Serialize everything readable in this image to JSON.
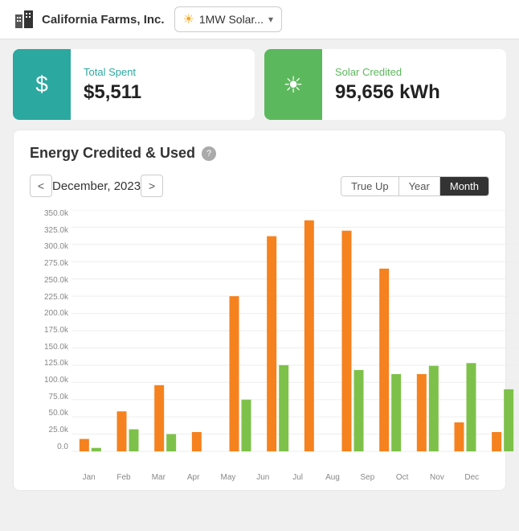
{
  "header": {
    "company": "California Farms, Inc.",
    "site": "1MW Solar...",
    "logo_alt": "building-icon"
  },
  "cards": [
    {
      "id": "total-spent",
      "icon": "$",
      "icon_color": "teal",
      "label": "Total Spent",
      "value": "$5,511"
    },
    {
      "id": "solar-credited",
      "icon": "☀",
      "icon_color": "green",
      "label": "Solar Credited",
      "value": "95,656 kWh"
    }
  ],
  "chart": {
    "title": "Energy Credited & Used",
    "help": "?",
    "nav": {
      "prev": "<",
      "next": ">",
      "date": "December, 2023"
    },
    "view_buttons": [
      "True Up",
      "Year",
      "Month"
    ],
    "active_view": "Month",
    "y_labels": [
      "350.0k",
      "325.0k",
      "300.0k",
      "275.0k",
      "250.0k",
      "225.0k",
      "200.0k",
      "175.0k",
      "150.0k",
      "125.0k",
      "100.0k",
      "75.0k",
      "50.0k",
      "25.0k",
      "0.0"
    ],
    "months": [
      "Jan",
      "Feb",
      "Mar",
      "Apr",
      "May",
      "Jun",
      "Jul",
      "Aug",
      "Sep",
      "Oct",
      "Nov",
      "Dec"
    ],
    "bars": [
      {
        "month": "Jan",
        "green": 5,
        "orange": 18
      },
      {
        "month": "Feb",
        "green": 32,
        "orange": 58
      },
      {
        "month": "Mar",
        "green": 25,
        "orange": 96
      },
      {
        "month": "Apr",
        "green": 0,
        "orange": 28
      },
      {
        "month": "May",
        "green": 75,
        "orange": 225
      },
      {
        "month": "Jun",
        "green": 125,
        "orange": 312
      },
      {
        "month": "Jul",
        "green": 0,
        "orange": 335
      },
      {
        "month": "Aug",
        "green": 118,
        "orange": 320
      },
      {
        "month": "Sep",
        "green": 112,
        "orange": 265
      },
      {
        "month": "Oct",
        "green": 124,
        "orange": 112
      },
      {
        "month": "Nov",
        "green": 128,
        "orange": 42
      },
      {
        "month": "Dec",
        "green": 90,
        "orange": 28
      }
    ]
  }
}
